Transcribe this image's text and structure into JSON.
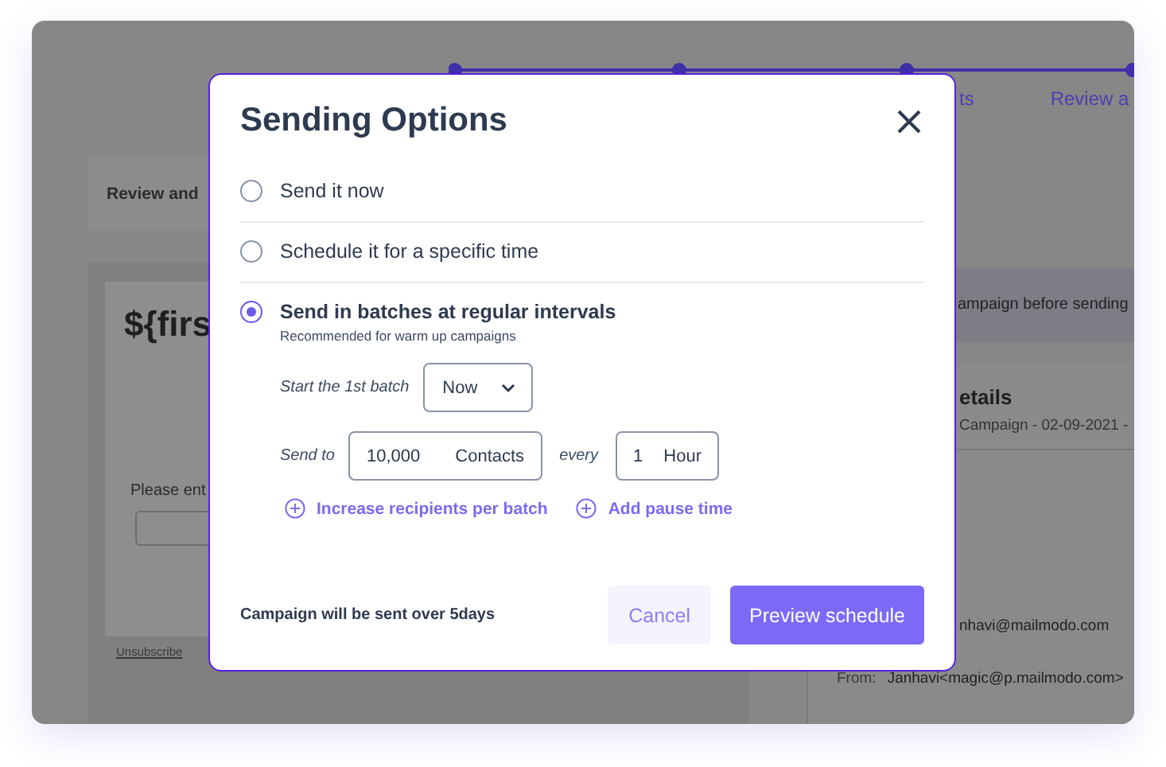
{
  "background": {
    "stepper_labels": [
      "ts",
      "Review a"
    ],
    "section_title": "Review and",
    "email_preview": {
      "heading": "${firs",
      "prompt": "Please ent",
      "footer_link": "Unsubscribe"
    },
    "notice": "ampaign before sending",
    "details": {
      "title": "etails",
      "subtitle": "Campaign - 02-09-2021 -",
      "email": "nhavi@mailmodo.com",
      "from_label": "From:",
      "from_value": "Janhavi<magic@p.mailmodo.com>"
    }
  },
  "dialog": {
    "title": "Sending Options",
    "options": [
      {
        "label": "Send it now",
        "selected": false
      },
      {
        "label": "Schedule it for a specific time",
        "selected": false
      },
      {
        "label": "Send in batches at regular intervals",
        "note": "Recommended for warm up campaigns",
        "selected": true,
        "batch": {
          "start_label": "Start the 1st batch",
          "start_value": "Now",
          "send_to_label": "Send to",
          "count": "10,000",
          "count_unit": "Contacts",
          "every_label": "every",
          "interval": "1",
          "interval_unit": "Hour",
          "links": [
            "Increase recipients per batch",
            "Add pause time"
          ]
        }
      }
    ],
    "summary": "Campaign will be sent over 5days",
    "buttons": [
      {
        "label": "Cancel",
        "kind": "secondary"
      },
      {
        "label": "Preview schedule",
        "kind": "primary"
      }
    ]
  }
}
